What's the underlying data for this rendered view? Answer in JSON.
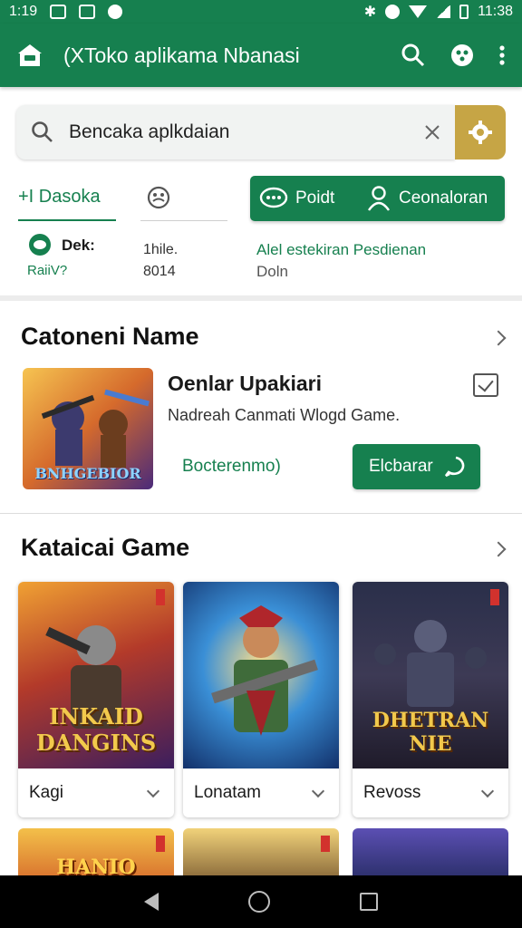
{
  "status_bar": {
    "time": "1:19",
    "clock_right": "11:38"
  },
  "app_bar": {
    "title": "(XToko aplikama Nbanasi",
    "icons": [
      "store-icon",
      "search-icon",
      "gamepad-icon",
      "more-vert-icon"
    ]
  },
  "search": {
    "value": "Bencaka aplkdaian",
    "icons": [
      "search-icon",
      "clear-icon",
      "settings-icon"
    ]
  },
  "tabs": {
    "tab1": "+I Dasoka",
    "tab2_icon": "emoji-icon"
  },
  "actions": {
    "primary_label": "Poidt",
    "secondary_label": "Ceonaloran"
  },
  "info": {
    "a_title": "Dek:",
    "a_sub": "RaiiV?",
    "b_line1": "1hile.",
    "b_line2": "8014",
    "c_line1": "Alel estekiran Pesdienan",
    "c_line2": "Doln"
  },
  "sections": {
    "featured_title": "Catoneni Name",
    "games_title": "Kataicai Game"
  },
  "featured": {
    "title": "Oenlar Upakiari",
    "description": "Nadreah Canmati Wlogd Game.",
    "link": "Bocterenmo)",
    "button": "Elcbarar",
    "logo_text": "BNHGEBIOR"
  },
  "games": [
    {
      "label": "Kagi",
      "logo": "INKAID DANGINS"
    },
    {
      "label": "Lonatam",
      "logo": ""
    },
    {
      "label": "Revoss",
      "logo": "DHETRAN NIE"
    }
  ],
  "row2": [
    {
      "logo": "HANIO"
    },
    {
      "logo": ""
    },
    {
      "logo": ""
    }
  ],
  "colors": {
    "primary": "#16804f",
    "accent": "#c6a545",
    "nav": "#000000"
  }
}
